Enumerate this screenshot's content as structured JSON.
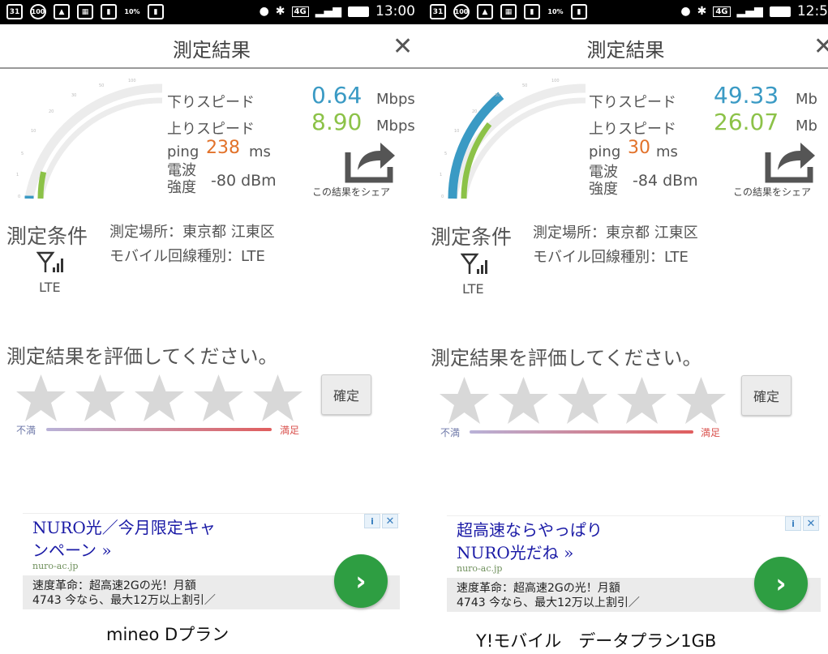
{
  "panels": [
    {
      "status": {
        "time": "13:00",
        "network": "4G",
        "calendar_day": "31",
        "mail_badge": "100",
        "battery_percent": "10%"
      },
      "title": "測定結果",
      "close_symbol": "✕",
      "gauge": {
        "download_fraction": 0.013,
        "upload_fraction": 0.14
      },
      "download": {
        "label": "下りスピード",
        "value": "0.64",
        "unit": "Mbps"
      },
      "upload": {
        "label": "上りスピード",
        "value": "8.90",
        "unit": "Mbps"
      },
      "ping": {
        "label": "ping",
        "value": "238",
        "unit": "ms"
      },
      "signal": {
        "label_line1": "電波",
        "label_line2": "強度",
        "value": "-80 dBm"
      },
      "share": {
        "label": "この結果をシェア"
      },
      "conditions": {
        "title": "測定条件",
        "location": "測定場所：東京都 江東区",
        "line_type": "モバイル回線種別：LTE",
        "network": "LTE"
      },
      "rating": {
        "question": "測定結果を評価してください。",
        "confirm": "確定",
        "min_label": "不満",
        "max_label": "満足",
        "stars": 5
      },
      "ad": {
        "headline_line1": "NURO光／今月限定キャ",
        "headline_line2": "ンペーン »",
        "domain": "nuro-ac.jp",
        "desc_line1": "速度革命：超高速2Gの光！月額",
        "desc_line2": "4743 今なら、最大12万以上割引／",
        "info": "i",
        "close": "✕",
        "go": "›"
      },
      "caption": "mineo Dプラン"
    },
    {
      "status": {
        "time": "12:5",
        "network": "4G",
        "calendar_day": "31",
        "mail_badge": "100",
        "battery_percent": "10%"
      },
      "title": "測定結果",
      "close_symbol": "✕",
      "gauge": {
        "download_fraction": 0.56,
        "upload_fraction": 0.42
      },
      "download": {
        "label": "下りスピード",
        "value": "49.33",
        "unit": "Mb"
      },
      "upload": {
        "label": "上りスピード",
        "value": "26.07",
        "unit": "Mb"
      },
      "ping": {
        "label": "ping",
        "value": "30",
        "unit": "ms"
      },
      "signal": {
        "label_line1": "電波",
        "label_line2": "強度",
        "value": "-84 dBm"
      },
      "share": {
        "label": "この結果をシェア"
      },
      "conditions": {
        "title": "測定条件",
        "location": "測定場所：東京都 江東区",
        "line_type": "モバイル回線種別：LTE",
        "network": "LTE"
      },
      "rating": {
        "question": "測定結果を評価してください。",
        "confirm": "確定",
        "min_label": "不満",
        "max_label": "満足",
        "stars": 5
      },
      "ad": {
        "headline_line1": "超高速ならやっぱり",
        "headline_line2": "NURO光だね »",
        "domain": "nuro-ac.jp",
        "desc_line1": "速度革命：超高速2Gの光！月額",
        "desc_line2": "4743 今なら、最大12万以上割引／",
        "info": "i",
        "close": "✕",
        "go": "›"
      },
      "caption": "Y!モバイル　データプラン1GB"
    }
  ],
  "colors": {
    "download": "#3a9ac4",
    "upload": "#8cc248",
    "ping": "#e2722a",
    "ad_button": "#2e9e42",
    "ad_headline": "#1a1aa6"
  },
  "icons": [
    "calendar-icon",
    "mail-icon",
    "image-icon",
    "grid-icon",
    "sdcard-icon",
    "wifi-hotspot-icon",
    "location-icon",
    "bluetooth-icon",
    "signal-icon",
    "battery-icon",
    "share-icon",
    "antenna-icon",
    "star-icon",
    "info-icon",
    "close-icon",
    "chevron-right-icon"
  ]
}
